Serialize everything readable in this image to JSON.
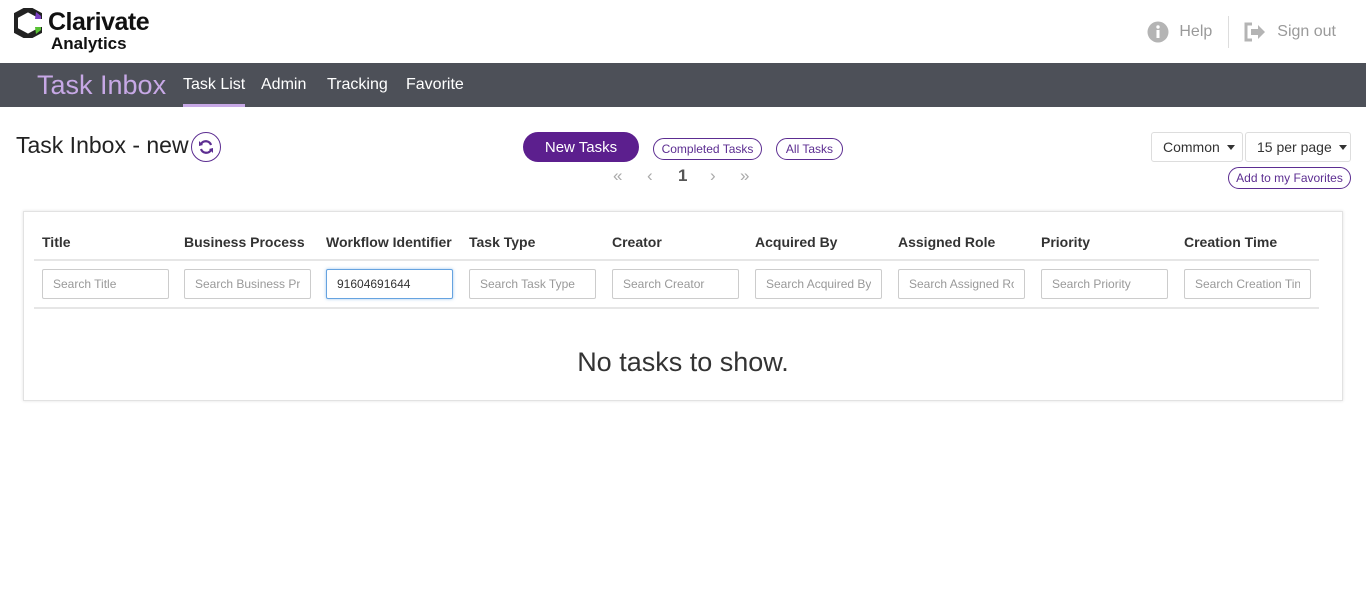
{
  "header": {
    "logo_line1": "Clarivate",
    "logo_line2": "Analytics",
    "help_label": "Help",
    "signout_label": "Sign out",
    "help_icon": "info-circle-icon",
    "signout_icon": "sign-out-icon"
  },
  "nav": {
    "brand": "Task Inbox",
    "items": [
      {
        "label": "Task List",
        "active": true
      },
      {
        "label": "Admin"
      },
      {
        "label": "Tracking"
      },
      {
        "label": "Favorite"
      }
    ]
  },
  "page": {
    "title": "Task Inbox - new",
    "refresh_icon": "refresh-icon",
    "new_tasks_label": "New Tasks",
    "completed_tasks_label": "Completed Tasks",
    "all_tasks_label": "All Tasks",
    "current_page": "1",
    "pager_icons": [
      "first-page-icon",
      "prev-page-icon",
      "next-page-icon",
      "last-page-icon"
    ],
    "view_select": "Common",
    "per_page_select": "15 per page",
    "add_favorites_label": "Add to my Favorites"
  },
  "table": {
    "columns": [
      {
        "label": "Title",
        "placeholder": "Search Title",
        "value": ""
      },
      {
        "label": "Business Process",
        "placeholder": "Search Business Pr",
        "value": ""
      },
      {
        "label": "Workflow Identifier",
        "placeholder": "",
        "value": "91604691644"
      },
      {
        "label": "Task Type",
        "placeholder": "Search Task Type",
        "value": ""
      },
      {
        "label": "Creator",
        "placeholder": "Search Creator",
        "value": ""
      },
      {
        "label": "Acquired By",
        "placeholder": "Search Acquired By",
        "value": ""
      },
      {
        "label": "Assigned Role",
        "placeholder": "Search Assigned Ro",
        "value": ""
      },
      {
        "label": "Priority",
        "placeholder": "Search Priority",
        "value": ""
      },
      {
        "label": "Creation Time",
        "placeholder": "Search Creation Tin",
        "value": ""
      }
    ],
    "empty_message": "No tasks to show."
  },
  "colors": {
    "accent": "#5c1f8e",
    "brand_lavender": "#c7a8e6",
    "navbar": "#4d5058"
  }
}
